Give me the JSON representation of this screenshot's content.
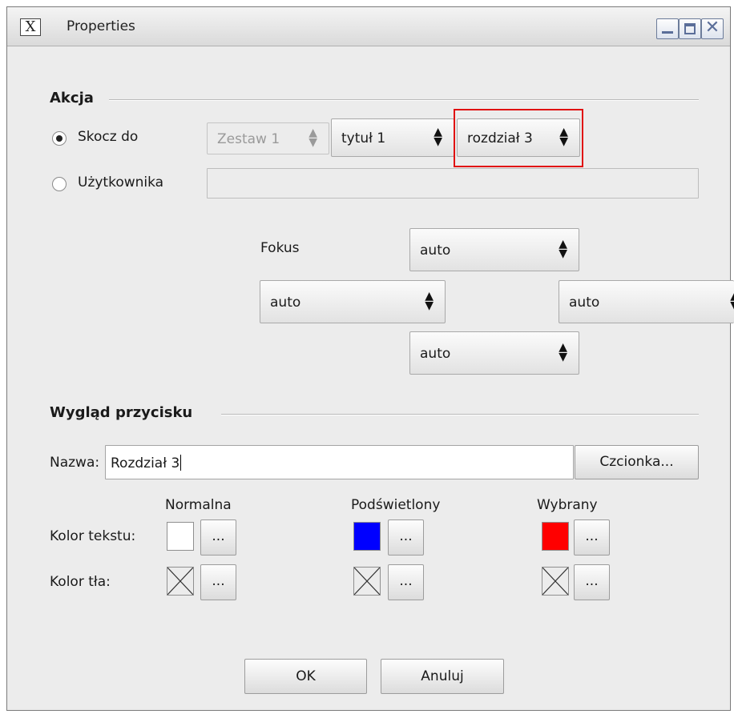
{
  "window": {
    "title": "Properties",
    "app_icon_glyph": "X",
    "controls": [
      "minimize-icon",
      "maximize-icon",
      "close-icon"
    ]
  },
  "akcja": {
    "group_title": "Akcja",
    "jump_to": {
      "label": "Skocz do",
      "selected": true,
      "zestaw": "Zestaw 1",
      "tytul": "tytuł 1",
      "rozdzial": "rozdział 3"
    },
    "user": {
      "label": "Użytkownika",
      "selected": false,
      "value": ""
    },
    "focus": {
      "label": "Fokus",
      "top": "auto",
      "left": "auto",
      "right": "auto",
      "bottom": "auto"
    }
  },
  "appearance": {
    "group_title": "Wygląd przycisku",
    "name_label": "Nazwa:",
    "name_value": "Rozdział 3",
    "font_button": "Czcionka...",
    "columns": [
      "Normalna",
      "Podświetlony",
      "Wybrany"
    ],
    "text_color_label": "Kolor tekstu:",
    "bg_color_label": "Kolor tła:",
    "text_colors": [
      "#ffffff",
      "#0000ff",
      "#ff0000"
    ],
    "bg_colors": [
      "none",
      "none",
      "none"
    ],
    "picker_label": "..."
  },
  "buttons": {
    "ok": "OK",
    "cancel": "Anuluj"
  },
  "highlight_color": "#e01010"
}
